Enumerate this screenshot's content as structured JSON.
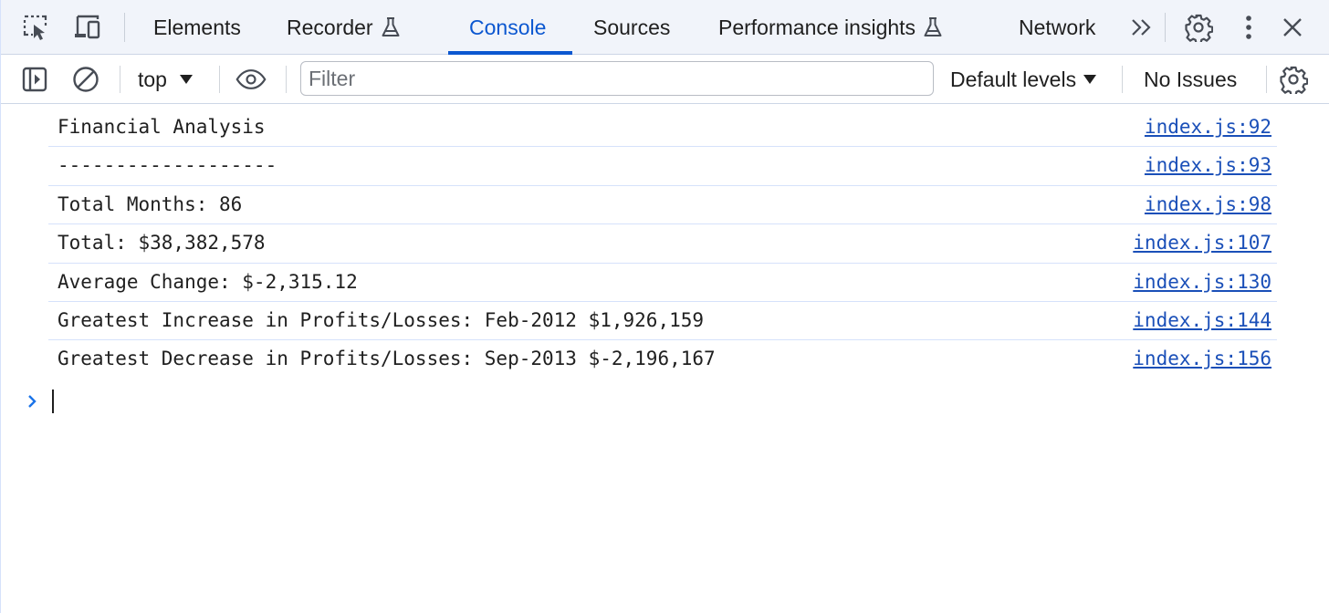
{
  "tabs": [
    {
      "label": "Elements",
      "active": false
    },
    {
      "label": "Recorder",
      "active": false,
      "experimental": true
    },
    {
      "label": "Console",
      "active": true
    },
    {
      "label": "Sources",
      "active": false
    },
    {
      "label": "Performance insights",
      "active": false,
      "experimental": true
    },
    {
      "label": "Network",
      "active": false
    }
  ],
  "toolbar": {
    "context": "top",
    "filter_placeholder": "Filter",
    "filter_value": "",
    "levels": "Default levels",
    "issues": "No Issues"
  },
  "messages": [
    {
      "text": "Financial Analysis",
      "source": "index.js:92"
    },
    {
      "text": "-------------------",
      "source": "index.js:93"
    },
    {
      "text": "Total Months: 86",
      "source": "index.js:98"
    },
    {
      "text": "Total: $38,382,578",
      "source": "index.js:107"
    },
    {
      "text": "Average Change: $-2,315.12",
      "source": "index.js:130"
    },
    {
      "text": "Greatest Increase in Profits/Losses: Feb-2012 $1,926,159",
      "source": "index.js:144"
    },
    {
      "text": "Greatest Decrease in Profits/Losses: Sep-2013 $-2,196,167",
      "source": "index.js:156"
    }
  ],
  "icons": {
    "inspect": "inspect-element-icon",
    "device": "device-toolbar-icon",
    "more_tabs": "chevron-double-right-icon",
    "settings": "gear-icon",
    "menu": "kebab-menu-icon",
    "close": "close-icon",
    "sidebar": "sidebar-toggle-icon",
    "clear": "clear-console-icon",
    "eye": "live-expression-eye-icon",
    "prompt": "prompt-chevron-icon"
  },
  "colors": {
    "accent": "#0b57d0",
    "link": "#1a4fb8",
    "tabbar_bg": "#f1f4fa",
    "divider": "#d6e2fb"
  }
}
